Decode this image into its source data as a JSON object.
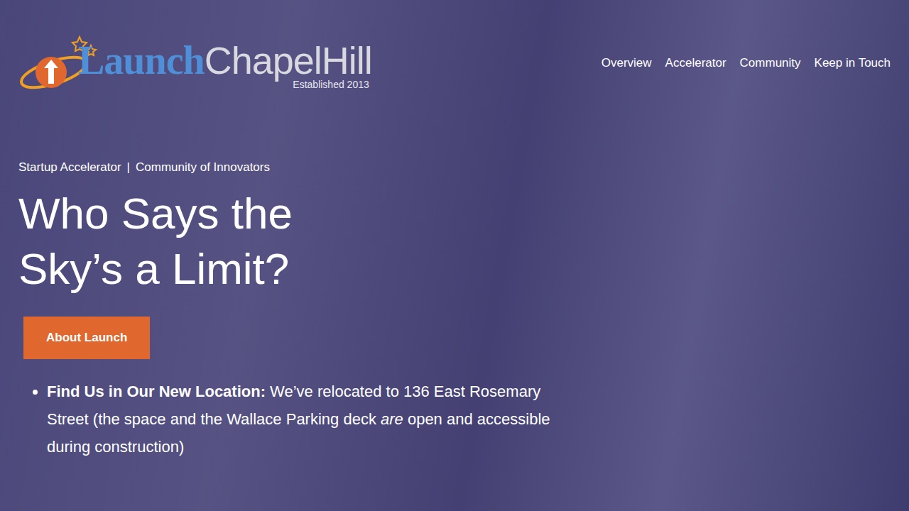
{
  "logo": {
    "primary": "Launch",
    "secondary": "ChapelHill",
    "tagline": "Established 2013"
  },
  "nav": [
    {
      "label": "Overview"
    },
    {
      "label": "Accelerator"
    },
    {
      "label": "Community"
    },
    {
      "label": "Keep in Touch"
    }
  ],
  "hero": {
    "eyebrow": [
      "Startup Accelerator",
      "Community of Innovators"
    ],
    "separator": "|",
    "title_lines": [
      "Who Says the",
      "Sky’s a Limit?"
    ],
    "button": "About Launch"
  },
  "notices": [
    {
      "label": "Find Us in Our New Location:",
      "text_before": " We’ve relocated to 136 East Rosemary Street (the space and the Wallace Parking deck ",
      "emphasis": "are",
      "text_after": " open and accessible during construction)"
    }
  ]
}
